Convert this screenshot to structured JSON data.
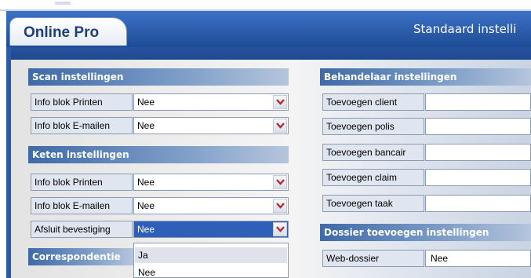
{
  "app": {
    "tab_title": "Online Pro",
    "window_title": "Standaard instelli"
  },
  "scan": {
    "heading": "Scan instellingen",
    "rows": [
      {
        "label": "Info blok Printen",
        "value": "Nee"
      },
      {
        "label": "Info blok E-mailen",
        "value": "Nee"
      }
    ]
  },
  "keten": {
    "heading": "Keten instellingen",
    "rows": [
      {
        "label": "Info blok Printen",
        "value": "Nee"
      },
      {
        "label": "Info blok E-mailen",
        "value": "Nee"
      },
      {
        "label": "Afsluit bevestiging",
        "value": "Nee"
      }
    ]
  },
  "correspondentie": {
    "heading": "Correspondentie"
  },
  "dropdown": {
    "options": [
      "Ja",
      "Nee"
    ],
    "highlighted": "Ja"
  },
  "behandelaar": {
    "heading": "Behandelaar instellingen",
    "rows": [
      {
        "label": "Toevoegen client",
        "value": ""
      },
      {
        "label": "Toevoegen polis",
        "value": ""
      },
      {
        "label": "Toevoegen bancair",
        "value": ""
      },
      {
        "label": "Toevoegen claim",
        "value": ""
      },
      {
        "label": "Toevoegen taak",
        "value": ""
      }
    ]
  },
  "dossier": {
    "heading": "Dossier toevoegen instellingen",
    "rows": [
      {
        "label": "Web-dossier",
        "value": "Nee"
      }
    ]
  },
  "colors": {
    "header_blue": "#2a5aa8",
    "focus_blue": "#2f5fb8",
    "chevron_red": "#c0252d"
  },
  "icons": {
    "dropdown": "chevron-down-icon"
  }
}
